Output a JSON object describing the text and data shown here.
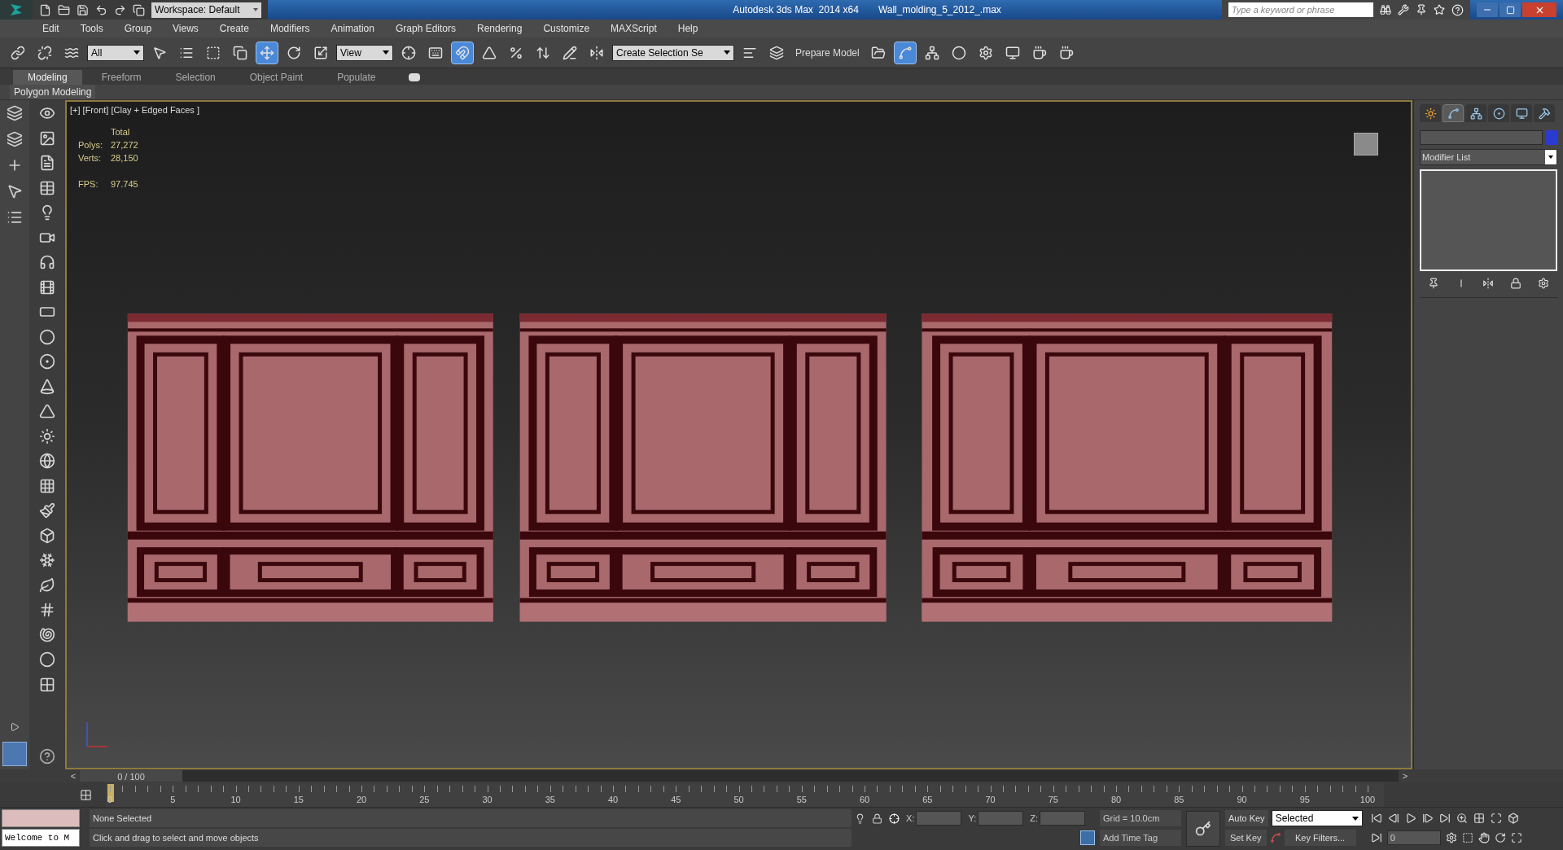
{
  "title_bar": {
    "workspace": "Workspace: Default",
    "app_title": "Autodesk 3ds Max  2014 x64",
    "file_name": "Wall_molding_5_2012_.max",
    "search": {
      "placeholder": "Type a keyword or phrase"
    }
  },
  "menu": [
    "Edit",
    "Tools",
    "Group",
    "Views",
    "Create",
    "Modifiers",
    "Animation",
    "Graph Editors",
    "Rendering",
    "Customize",
    "MAXScript",
    "Help"
  ],
  "main_toolbar": [
    {
      "kind": "button",
      "selected": false
    },
    {
      "kind": "button",
      "selected": false
    },
    {
      "kind": "button",
      "selected": false
    },
    {
      "kind": "dropdown",
      "value": "All"
    },
    {
      "kind": "button",
      "selected": false
    },
    {
      "kind": "button",
      "selected": false
    },
    {
      "kind": "button",
      "selected": false
    },
    {
      "kind": "button",
      "selected": false
    },
    {
      "kind": "button",
      "selected": true
    },
    {
      "kind": "button",
      "selected": false
    },
    {
      "kind": "button",
      "selected": false
    },
    {
      "kind": "dropdown",
      "value": "View"
    },
    {
      "kind": "button",
      "selected": false
    },
    {
      "kind": "button",
      "selected": false
    },
    {
      "kind": "button",
      "selected": true
    },
    {
      "kind": "button",
      "selected": false
    },
    {
      "kind": "button",
      "selected": false
    },
    {
      "kind": "button",
      "selected": false
    },
    {
      "kind": "button",
      "selected": false
    },
    {
      "kind": "button",
      "selected": false
    },
    {
      "kind": "dropdown",
      "value": "Create Selection Se"
    },
    {
      "kind": "button",
      "selected": false
    },
    {
      "kind": "button",
      "selected": false
    },
    {
      "kind": "text_button",
      "label": "Prepare Model"
    },
    {
      "kind": "button",
      "selected": false
    },
    {
      "kind": "button",
      "selected": true
    },
    {
      "kind": "button",
      "selected": false
    },
    {
      "kind": "button",
      "selected": false
    },
    {
      "kind": "button",
      "selected": false
    },
    {
      "kind": "button",
      "selected": false
    },
    {
      "kind": "button",
      "selected": false
    },
    {
      "kind": "button",
      "selected": false
    }
  ],
  "ribbon": {
    "tabs": [
      {
        "label": "Modeling",
        "selected": true
      },
      {
        "label": "Freeform",
        "selected": false
      },
      {
        "label": "Selection",
        "selected": false
      },
      {
        "label": "Object Paint",
        "selected": false
      },
      {
        "label": "Populate",
        "selected": false
      }
    ],
    "panel": "Polygon Modeling"
  },
  "viewport": {
    "label": "[+] [Front] [Clay + Edged Faces ]",
    "stats": {
      "heading": "Total",
      "rows": [
        {
          "label": "Polys:",
          "value": "27,272"
        },
        {
          "label": "Verts:",
          "value": "28,150"
        }
      ],
      "fps_label": "FPS:",
      "fps_value": "97.745"
    }
  },
  "command_panel": {
    "tabs": [
      {
        "selected": false
      },
      {
        "selected": true
      },
      {
        "selected": false
      },
      {
        "selected": false
      },
      {
        "selected": false
      },
      {
        "selected": false
      }
    ],
    "modifier_list": "Modifier List"
  },
  "time_slider": {
    "prev": "<",
    "position": "0 / 100",
    "level": 0,
    "next": ">"
  },
  "track_bar": {
    "ticks": [
      "0",
      "5",
      "10",
      "15",
      "20",
      "25",
      "30",
      "35",
      "40",
      "45",
      "50",
      "55",
      "60",
      "65",
      "70",
      "75",
      "80",
      "85",
      "90",
      "95",
      "100"
    ]
  },
  "status": {
    "listener": "Welcome to M",
    "selection": "None Selected",
    "prompt": "Click and drag to select and move objects",
    "x_label": "X:",
    "y_label": "Y:",
    "z_label": "Z:",
    "grid": "Grid = 10.0cm",
    "add_time_tag": "Add Time Tag",
    "auto_key": "Auto Key",
    "key_mode": "Selected",
    "set_key": "Set Key",
    "key_filters": "Key Filters...",
    "frame": "0"
  }
}
